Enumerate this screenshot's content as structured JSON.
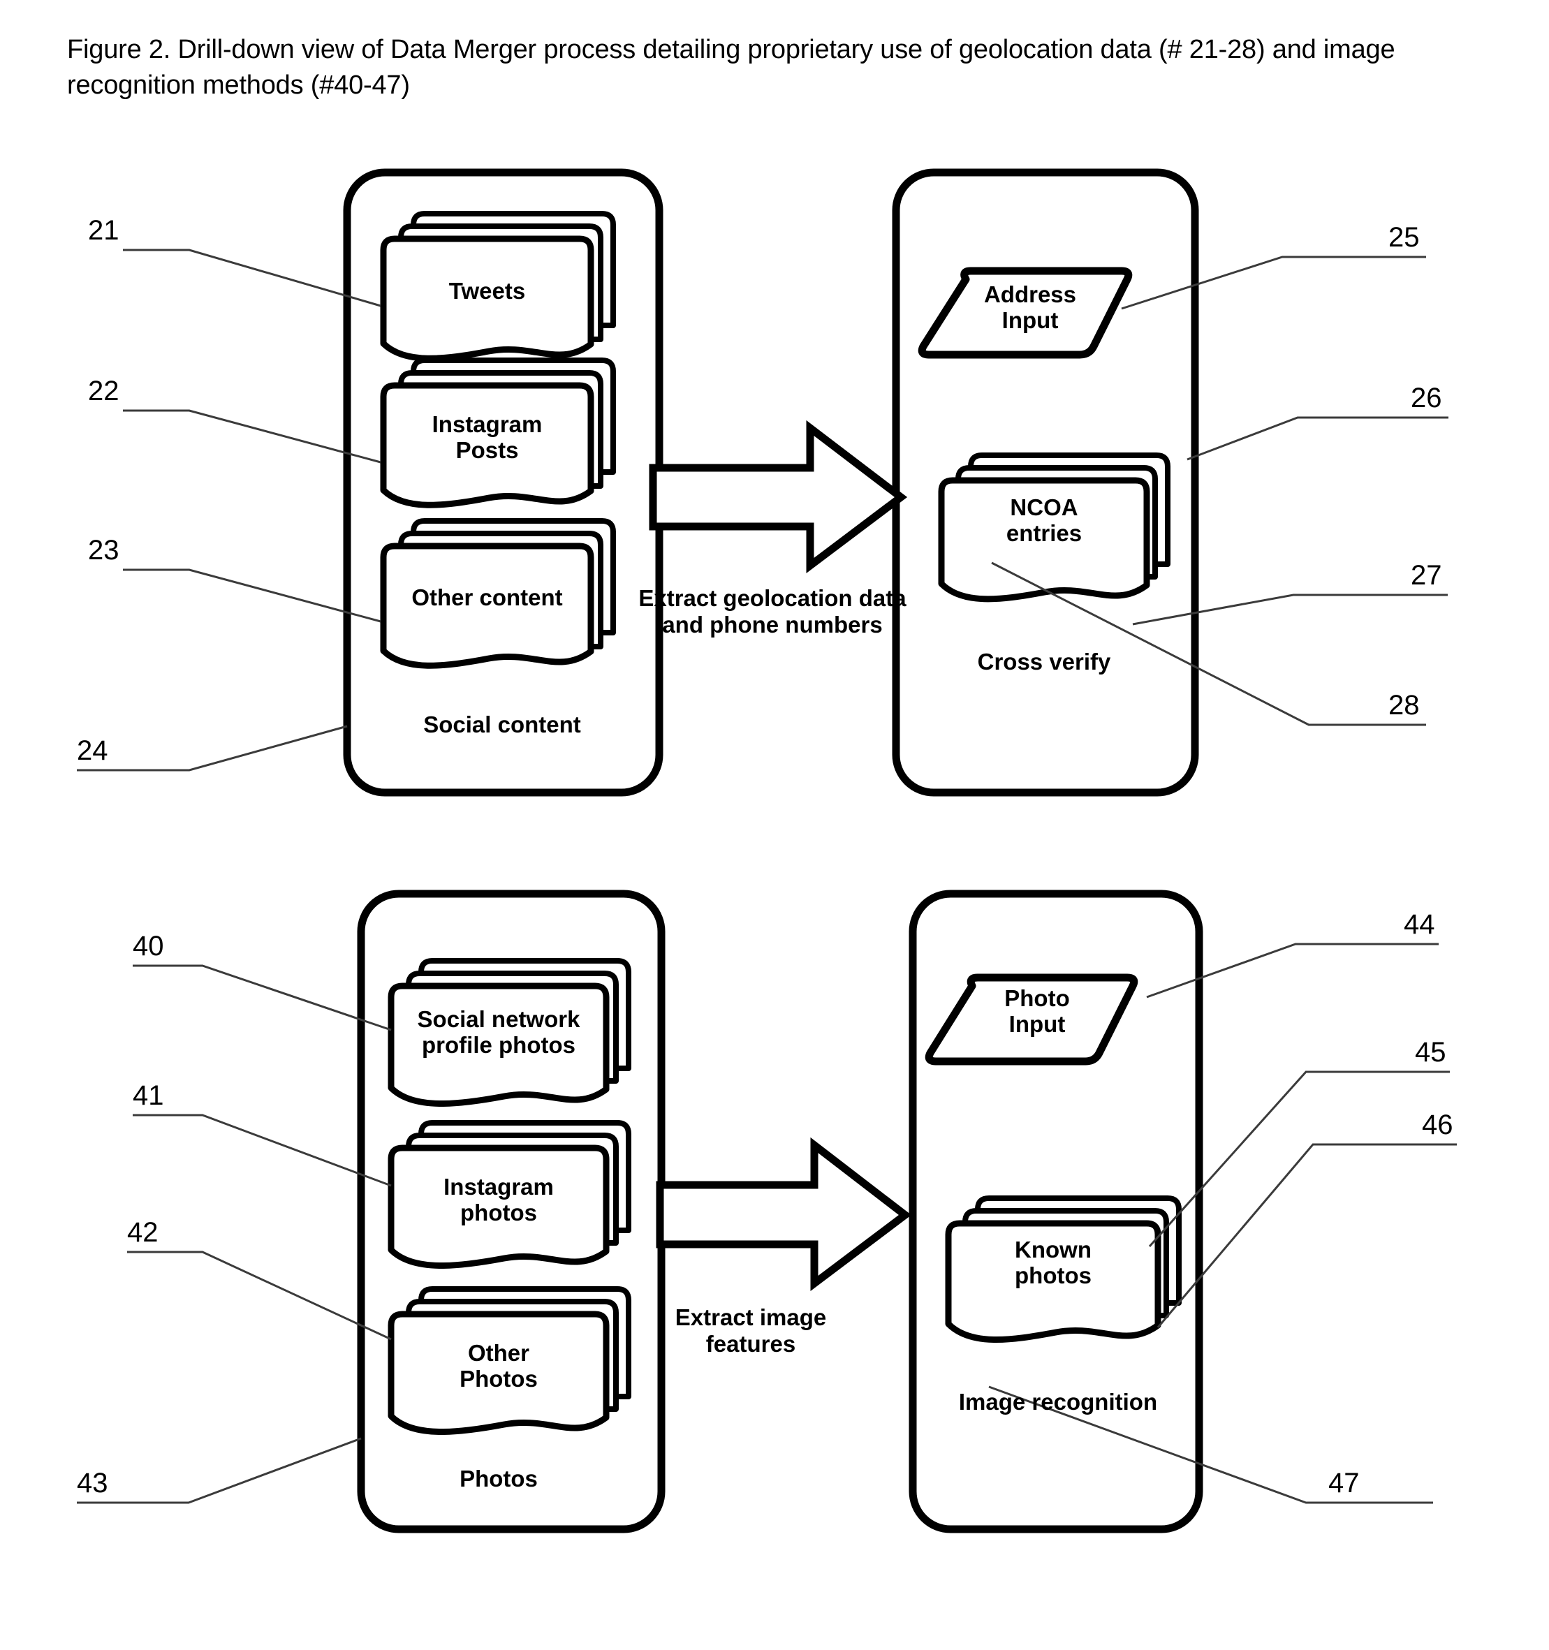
{
  "figure": {
    "caption": "Figure 2.  Drill-down view of Data Merger process detailing proprietary use of geolocation data (# 21-28) and image recognition methods (#40-47)"
  },
  "colors": {
    "stroke": "#000000",
    "fill": "#ffffff",
    "leader": "#3b3b3b"
  },
  "top_diagram": {
    "left_group": {
      "label": "Social content",
      "documents": [
        {
          "label": "Tweets"
        },
        {
          "label": "Instagram\nPosts"
        },
        {
          "label": "Other content"
        }
      ]
    },
    "arrow": {
      "label": "Extract geolocation data\nand phone numbers"
    },
    "right_group": {
      "input": {
        "label": "Address\nInput"
      },
      "documents": [
        {
          "label": "NCOA\nentries"
        }
      ],
      "label": "Cross verify"
    },
    "refs": [
      {
        "id": "21",
        "label": "21"
      },
      {
        "id": "22",
        "label": "22"
      },
      {
        "id": "23",
        "label": "23"
      },
      {
        "id": "24",
        "label": "24"
      },
      {
        "id": "25",
        "label": "25"
      },
      {
        "id": "26",
        "label": "26"
      },
      {
        "id": "27",
        "label": "27"
      },
      {
        "id": "28",
        "label": "28"
      }
    ]
  },
  "bottom_diagram": {
    "left_group": {
      "label": "Photos",
      "documents": [
        {
          "label": "Social network\nprofile photos"
        },
        {
          "label": "Instagram\nphotos"
        },
        {
          "label": "Other\nPhotos"
        }
      ]
    },
    "arrow": {
      "label": "Extract image\nfeatures"
    },
    "right_group": {
      "input": {
        "label": "Photo\nInput"
      },
      "documents": [
        {
          "label": "Known\nphotos"
        }
      ],
      "label": "Image recognition"
    },
    "refs": [
      {
        "id": "40",
        "label": "40"
      },
      {
        "id": "41",
        "label": "41"
      },
      {
        "id": "42",
        "label": "42"
      },
      {
        "id": "43",
        "label": "43"
      },
      {
        "id": "44",
        "label": "44"
      },
      {
        "id": "45",
        "label": "45"
      },
      {
        "id": "46",
        "label": "46"
      },
      {
        "id": "47",
        "label": "47"
      }
    ]
  }
}
